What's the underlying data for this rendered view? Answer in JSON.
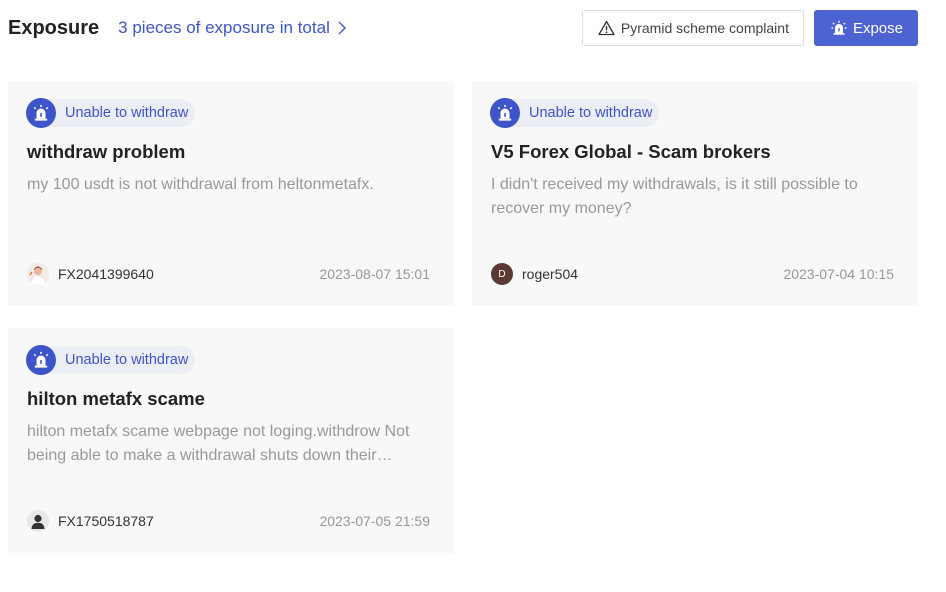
{
  "header": {
    "title": "Exposure",
    "total_link": "3 pieces of exposure in total",
    "complaint_label": "Pyramid scheme complaint",
    "expose_label": "Expose"
  },
  "colors": {
    "accent": "#4d63d1",
    "link": "#3d55c8",
    "card_bg": "#f8f8f9",
    "muted_text": "#999999"
  },
  "cards": [
    {
      "category": "Unable to withdraw",
      "title": "withdraw problem",
      "description": "my 100 usdt is not withdrawal from heltonmetafx.",
      "user": "FX2041399640",
      "avatar_icon": "user-photo-icon",
      "date": "2023-08-07 15:01"
    },
    {
      "category": "Unable to withdraw",
      "title": "V5 Forex Global - Scam brokers",
      "description": "I didn't received my withdrawals, is it still possible to recover my money?",
      "user": "roger504",
      "avatar_letter": "D",
      "date": "2023-07-04 10:15"
    },
    {
      "category": "Unable to withdraw",
      "title": "hilton metafx scame",
      "description": "hilton metafx scame webpage not loging.withdrow Not being able to make a withdrawal shuts down their…",
      "user": "FX1750518787",
      "avatar_icon": "default-user-icon",
      "date": "2023-07-05 21:59"
    }
  ]
}
